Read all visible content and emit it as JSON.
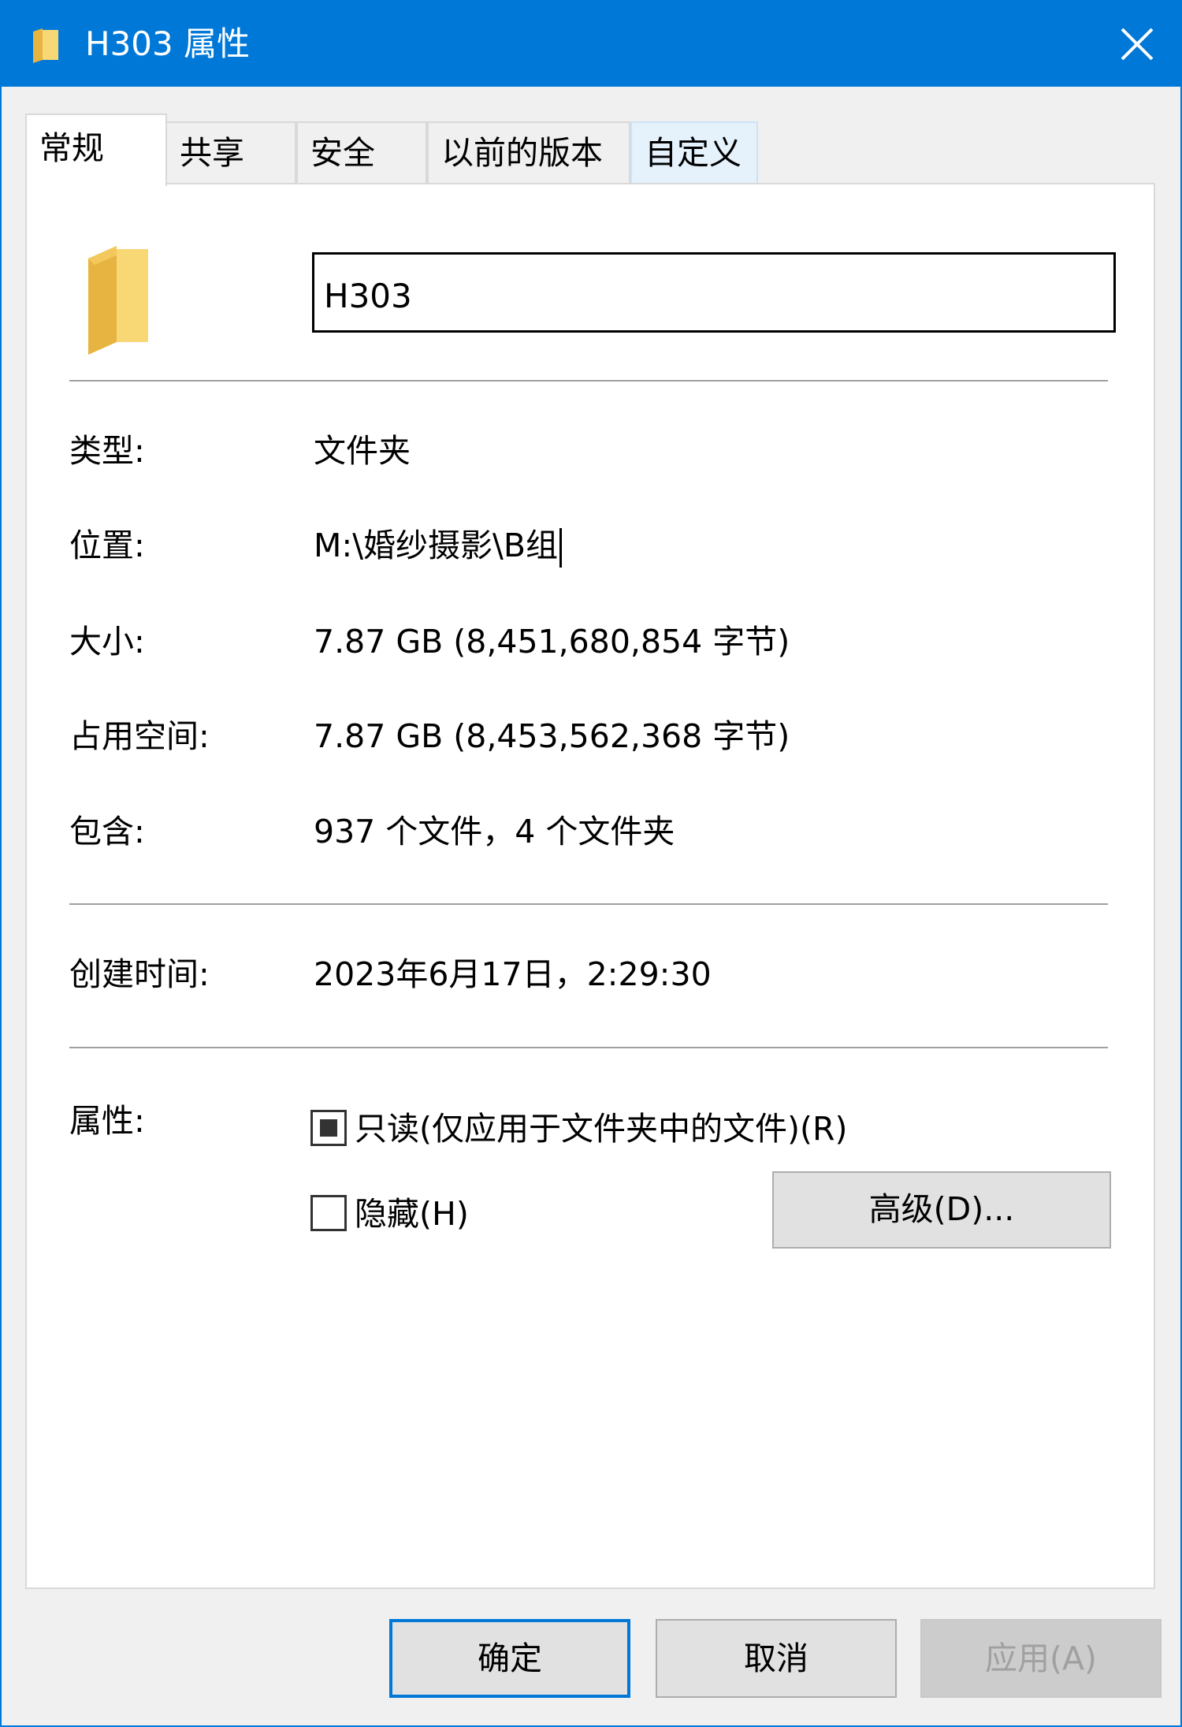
{
  "window": {
    "title": "H303 属性",
    "accent_color": "#0078d7"
  },
  "tabs": [
    {
      "label": "常规",
      "active": true
    },
    {
      "label": "共享"
    },
    {
      "label": "安全"
    },
    {
      "label": "以前的版本"
    },
    {
      "label": "自定义"
    }
  ],
  "general": {
    "name_value": "H303",
    "rows": [
      {
        "label": "类型:",
        "value": "文件夹"
      },
      {
        "label": "位置:",
        "value": "M:\\婚纱摄影\\B组"
      },
      {
        "label": "大小:",
        "value": "7.87 GB (8,451,680,854 字节)"
      },
      {
        "label": "占用空间:",
        "value": "7.87 GB (8,453,562,368 字节)"
      },
      {
        "label": "包含:",
        "value": "937 个文件，4 个文件夹"
      },
      {
        "label": "创建时间:",
        "value": "2023年6月17日，2:29:30"
      }
    ],
    "attributes_label": "属性:",
    "readonly_label": "只读(仅应用于文件夹中的文件)(R)",
    "readonly_state": "indeterminate",
    "hidden_label": "隐藏(H)",
    "hidden_checked": false,
    "advanced_label": "高级(D)..."
  },
  "footer": {
    "ok_label": "确定",
    "cancel_label": "取消",
    "apply_label": "应用(A)"
  }
}
